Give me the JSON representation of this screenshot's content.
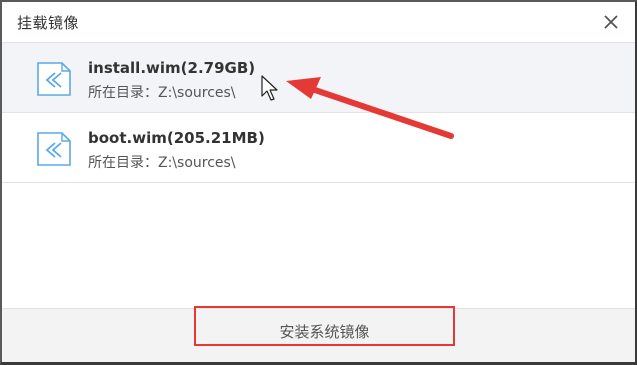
{
  "dialog": {
    "title": "挂载镜像"
  },
  "files": [
    {
      "name": "install.wim(2.79GB)",
      "path": "所在目录：Z:\\sources\\",
      "selected": true
    },
    {
      "name": "boot.wim(205.21MB)",
      "path": "所在目录：Z:\\sources\\",
      "selected": false
    }
  ],
  "footer": {
    "install_label": "安装系统镜像"
  },
  "colors": {
    "accent_red": "#e53935",
    "icon_blue": "#5aa9e6",
    "selected_bg": "#f2f4f7"
  },
  "icons": {
    "close": "close-icon",
    "file": "file-arrow-icon",
    "annotation": "red-arrow-icon",
    "cursor": "mouse-cursor-icon"
  }
}
